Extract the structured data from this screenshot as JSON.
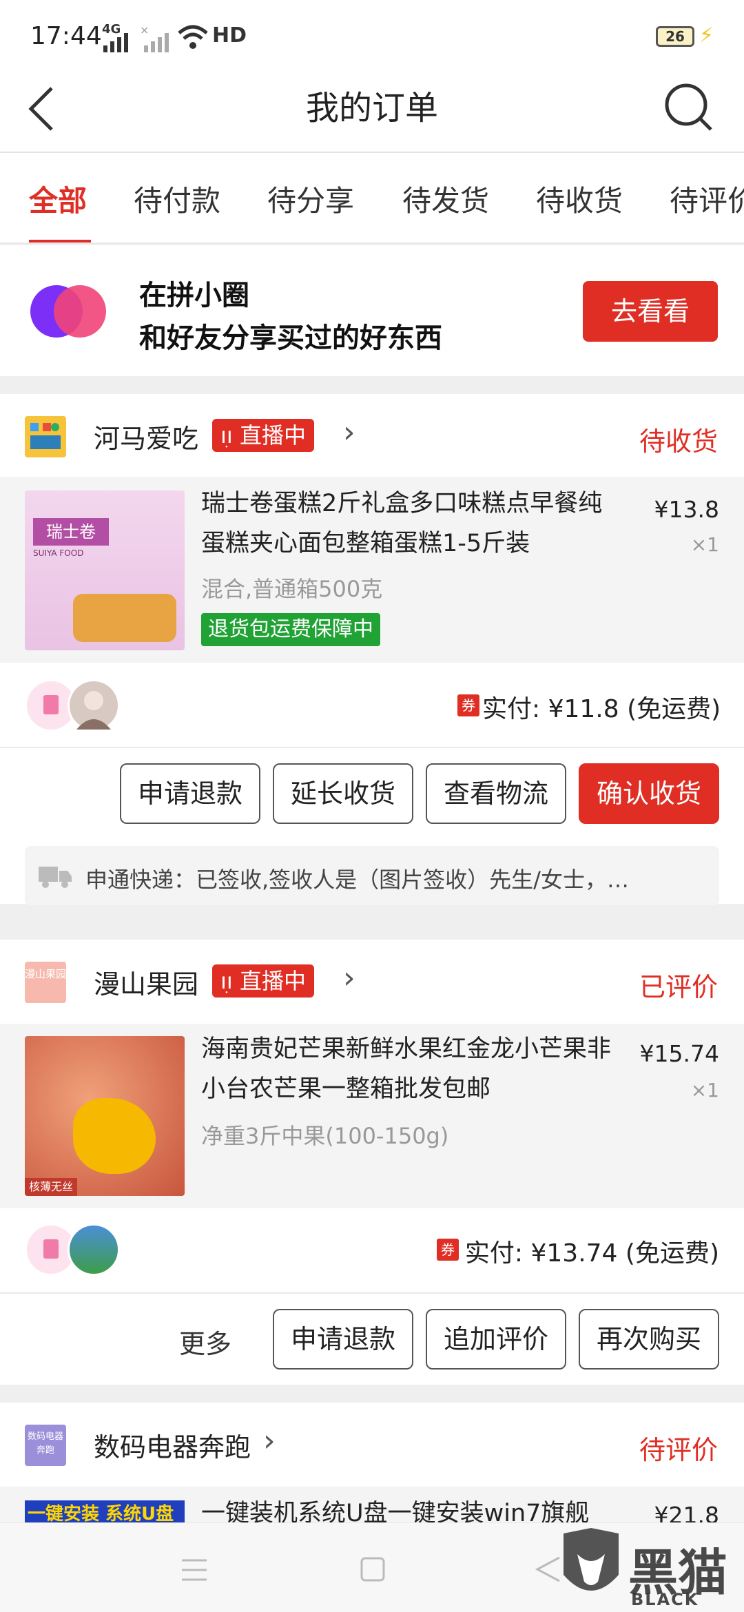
{
  "status_bar": {
    "time": "17:44",
    "network": "4G",
    "network2": "×",
    "hd": "HD",
    "battery": "26"
  },
  "header": {
    "title": "我的订单"
  },
  "tabs": [
    {
      "label": "全部",
      "active": true
    },
    {
      "label": "待付款"
    },
    {
      "label": "待分享"
    },
    {
      "label": "待发货"
    },
    {
      "label": "待收货"
    },
    {
      "label": "待评价"
    }
  ],
  "banner": {
    "line1": "在拼小圈",
    "line2": "和好友分享买过的好东西",
    "button": "去看看"
  },
  "orders": [
    {
      "shop": "河马爱吃",
      "live": "直播中",
      "status": "待收货",
      "title": "瑞士卷蛋糕2斤礼盒多口味糕点早餐纯蛋糕夹心面包整箱蛋糕1-5斤装",
      "spec": "混合,普通箱500克",
      "price": "¥13.8",
      "qty": "×1",
      "guarantee": "退货包运费保障中",
      "coupon": "券",
      "paid": "实付: ¥11.8 (免运费)",
      "buttons": [
        "申请退款",
        "延长收货",
        "查看物流",
        "确认收货"
      ],
      "logistics": "申通快递：已签收,签收人是（图片签收）先生/女士，…",
      "thumb_texts": [
        "瑞士卷",
        "SUIYA FOOD"
      ]
    },
    {
      "shop": "漫山果园",
      "shop_icon_text": "漫山果园",
      "live": "直播中",
      "status": "已评价",
      "title": "海南贵妃芒果新鲜水果红金龙小芒果非小台农芒果一整箱批发包邮",
      "spec": "净重3斤中果(100-150g)",
      "price": "¥15.74",
      "qty": "×1",
      "coupon": "券",
      "paid": "实付: ¥13.74 (免运费)",
      "more": "更多",
      "buttons": [
        "申请退款",
        "追加评价",
        "再次购买"
      ],
      "thumb_tag": "核薄无丝"
    },
    {
      "shop": "数码电器奔跑",
      "shop_icon_text": "数码电器奔跑",
      "status": "待评价",
      "title": "一键装机系统U盘一键安装win7旗舰",
      "price": "¥21.8",
      "thumb_tag": "一键安装 系统U盘"
    }
  ],
  "watermark": {
    "cn": "黑猫",
    "en": "BLACK CAT"
  }
}
